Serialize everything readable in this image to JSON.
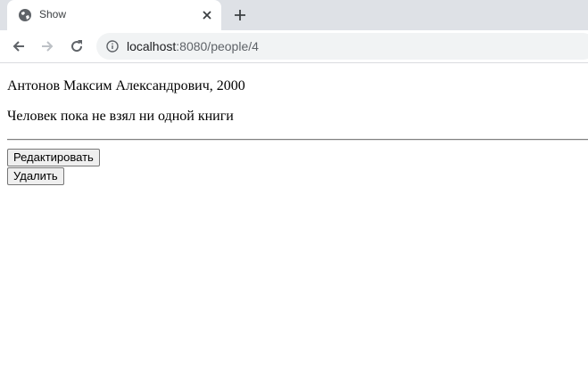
{
  "browser": {
    "tab": {
      "title": "Show",
      "icon": "globe-icon"
    },
    "nav": {
      "back_icon": "back-arrow-icon",
      "forward_icon": "forward-arrow-icon",
      "reload_icon": "reload-icon"
    },
    "address": {
      "host": "localhost",
      "path": ":8080/people/4"
    }
  },
  "page": {
    "person": "Антонов Максим Александрович, 2000",
    "books_status": "Человек пока не взял ни одной книги",
    "edit_label": "Редактировать",
    "delete_label": "Удалить"
  }
}
